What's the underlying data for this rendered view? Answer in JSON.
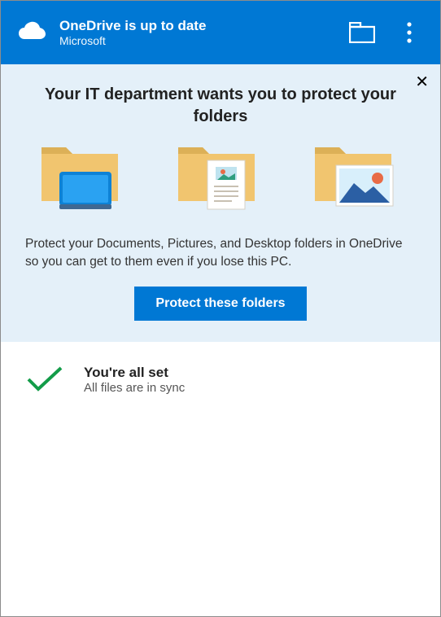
{
  "header": {
    "title": "OneDrive is up to date",
    "subtitle": "Microsoft"
  },
  "panel": {
    "title": "Your IT department wants you to protect your folders",
    "description": "Protect your Documents, Pictures, and Desktop folders in OneDrive so you can get to them even if you lose this PC.",
    "button_label": "Protect these folders"
  },
  "status": {
    "title": "You're all set",
    "subtitle": "All files are in sync"
  },
  "colors": {
    "accent": "#0078d4",
    "panel_bg": "#e4f0f9",
    "folder": "#f1c56f",
    "folder_shade": "#dcb057"
  }
}
